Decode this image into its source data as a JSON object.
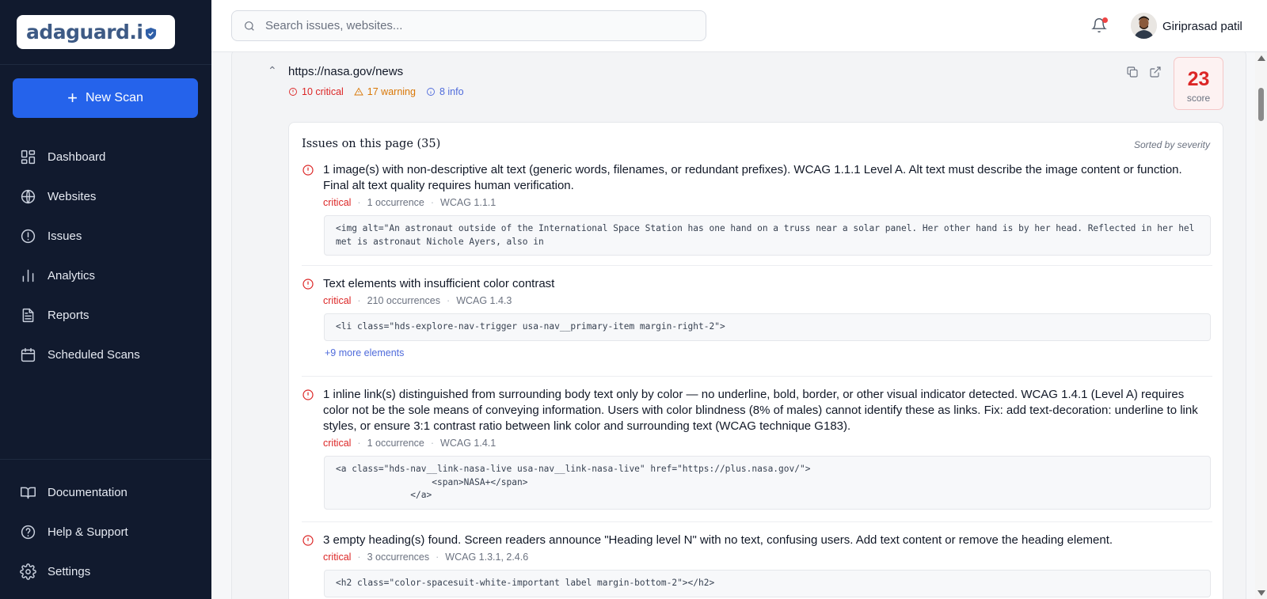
{
  "app": {
    "logo_text": "adaguard.i",
    "new_scan_label": "New Scan",
    "primary_color": "#2563eb",
    "sidebar_bg": "#111a2e",
    "nav_main": [
      {
        "label": "Dashboard",
        "icon": "dashboard-icon"
      },
      {
        "label": "Websites",
        "icon": "globe-icon"
      },
      {
        "label": "Issues",
        "icon": "alert-circle-icon"
      },
      {
        "label": "Analytics",
        "icon": "bar-chart-icon"
      },
      {
        "label": "Reports",
        "icon": "document-icon"
      },
      {
        "label": "Scheduled Scans",
        "icon": "calendar-icon"
      }
    ],
    "nav_bottom": [
      {
        "label": "Documentation",
        "icon": "book-icon"
      },
      {
        "label": "Help & Support",
        "icon": "help-circle-icon"
      },
      {
        "label": "Settings",
        "icon": "gear-icon"
      }
    ]
  },
  "topbar": {
    "search_placeholder": "Search issues, websites...",
    "user_name": "Giriprasad patil",
    "notification_dot_color": "#ef4444"
  },
  "page": {
    "url": "https://nasa.gov/news",
    "critical_label": "10 critical",
    "warning_label": "17 warning",
    "info_label": "8 info",
    "score": "23",
    "score_label": "score",
    "issues_title": "Issues on this page (35)",
    "sorted_label": "Sorted by severity"
  },
  "issues": [
    {
      "text": "1 image(s) with non-descriptive alt text (generic words, filenames, or redundant prefixes). WCAG 1.1.1 Level A. Alt text must describe the image content or function. Final alt text quality requires human verification.",
      "severity": "critical",
      "occurrences": "1 occurrence",
      "wcag": "WCAG 1.1.1",
      "code": "<img alt=\"An astronaut outside of the International Space Station has one hand on a truss near a solar panel. Her other hand is by her head. Reflected in her helmet is astronaut Nichole Ayers, also in",
      "more": ""
    },
    {
      "text": "Text elements with insufficient color contrast",
      "severity": "critical",
      "occurrences": "210 occurrences",
      "wcag": "WCAG 1.4.3",
      "code": "<li class=\"hds-explore-nav-trigger usa-nav__primary-item margin-right-2\">",
      "more": "+9 more elements"
    },
    {
      "text": "1 inline link(s) distinguished from surrounding body text only by color — no underline, bold, border, or other visual indicator detected. WCAG 1.4.1 (Level A) requires color not be the sole means of conveying information. Users with color blindness (8% of males) cannot identify these as links. Fix: add text-decoration: underline to link styles, or ensure 3:1 contrast ratio between link color and surrounding text (WCAG technique G183).",
      "severity": "critical",
      "occurrences": "1 occurrence",
      "wcag": "WCAG 1.4.1",
      "code": "<a class=\"hds-nav__link-nasa-live usa-nav__link-nasa-live\" href=\"https://plus.nasa.gov/\">\n                  <span>NASA+</span>\n              </a>",
      "more": ""
    },
    {
      "text": "3 empty heading(s) found. Screen readers announce \"Heading level N\" with no text, confusing users. Add text content or remove the heading element.",
      "severity": "critical",
      "occurrences": "3 occurrences",
      "wcag": "WCAG 1.3.1, 2.4.6",
      "code": "<h2 class=\"color-spacesuit-white-important label margin-bottom-2\"></h2>",
      "more": ""
    }
  ]
}
